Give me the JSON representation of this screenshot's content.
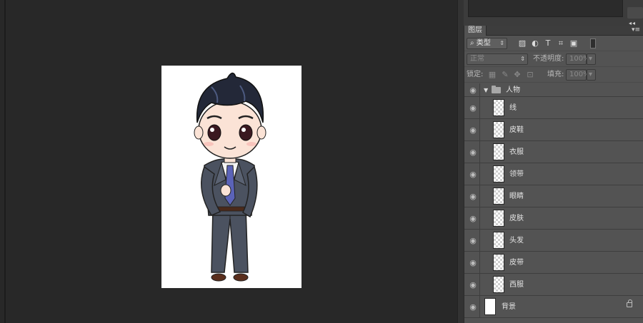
{
  "layers_panel": {
    "tab_label": "图层",
    "menu_icon": "panel-menu-icon",
    "filter": {
      "kind_label": "类型",
      "search_icon": "search-icon"
    },
    "blend_mode": "正常",
    "opacity_label": "不透明度:",
    "opacity_value": "100%",
    "lock_label": "锁定:",
    "fill_label": "填充:",
    "fill_value": "100%",
    "group": {
      "name": "人物",
      "expanded": true
    },
    "layers": [
      {
        "name": "线",
        "thumb": "line-art"
      },
      {
        "name": "皮鞋",
        "thumb": "transparent"
      },
      {
        "name": "衣服",
        "thumb": "transparent"
      },
      {
        "name": "领带",
        "thumb": "transparent"
      },
      {
        "name": "眼睛",
        "thumb": "transparent"
      },
      {
        "name": "皮肤",
        "thumb": "transparent"
      },
      {
        "name": "头发",
        "thumb": "transparent"
      },
      {
        "name": "皮带",
        "thumb": "transparent"
      },
      {
        "name": "西服",
        "thumb": "suit"
      }
    ],
    "background_layer": {
      "name": "背景",
      "locked": true
    }
  },
  "colors": {
    "canvas_bg": "#282828",
    "panel_bg": "#535353",
    "suit": "#4b5260",
    "tie": "#5b63b8",
    "hair": "#232838",
    "skin": "#fbe3d6"
  }
}
